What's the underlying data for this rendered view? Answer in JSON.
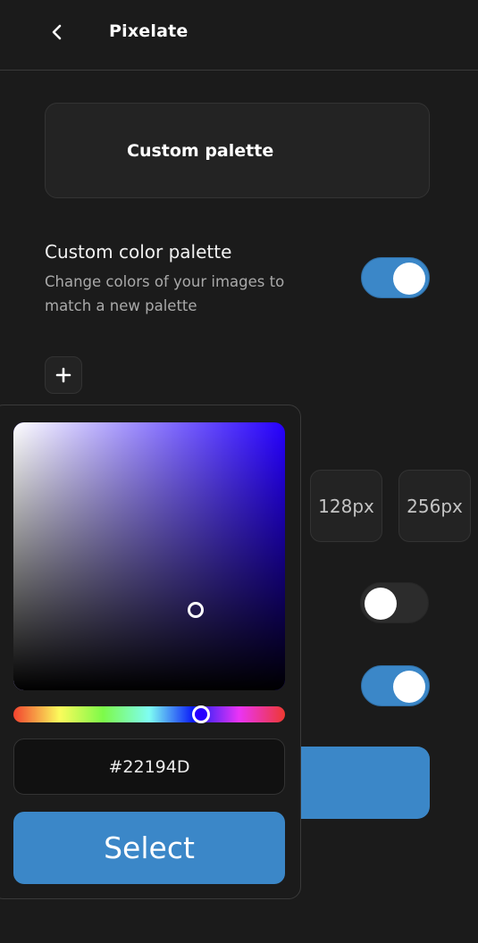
{
  "header": {
    "back_icon": "chevron-left-icon",
    "title": "Pixelate"
  },
  "mode_card": {
    "label": "Custom palette"
  },
  "custom_palette_setting": {
    "title": "Custom color palette",
    "description": "Change colors of your images to match a new palette",
    "enabled": true
  },
  "add_color_button": {
    "icon": "plus-icon"
  },
  "size_options": [
    {
      "label": "128px"
    },
    {
      "label": "256px"
    }
  ],
  "background_toggles": [
    {
      "enabled": false
    },
    {
      "enabled": true
    }
  ],
  "color_picker": {
    "hue_degrees": 249,
    "saturation": 0.67,
    "value": 0.3,
    "hex_value": "#22194D",
    "select_label": "Select"
  },
  "colors": {
    "background": "#1b1b1b",
    "accent": "#3b87c8",
    "card": "#232323"
  }
}
